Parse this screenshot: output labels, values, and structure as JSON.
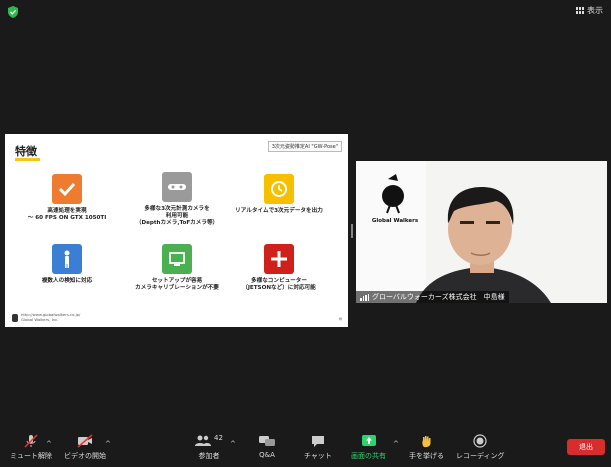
{
  "top": {
    "view_label": "表示"
  },
  "slide": {
    "title": "特徴",
    "tag": "3次元姿勢推定AI \"GW-Pose\"",
    "features": [
      {
        "line1": "高速処理を実現",
        "line2": "～ 60 FPS ON GTX 1050TI",
        "line3": "",
        "color": "#ee7c30",
        "icon": "check-icon"
      },
      {
        "line1": "多様な3次元計測カメラを",
        "line2": "利用可能",
        "line3": "（Depthカメラ,ToFカメラ等）",
        "color": "#9a9a9a",
        "icon": "camera-icon"
      },
      {
        "line1": "リアルタイムで3次元データを出力",
        "line2": "",
        "line3": "",
        "color": "#f6c000",
        "icon": "clock-icon"
      },
      {
        "line1": "複数人の検知に対応",
        "line2": "",
        "line3": "",
        "color": "#3b7fd4",
        "icon": "person-icon"
      },
      {
        "line1": "セットアップが容易",
        "line2": "カメラキャリブレーションが不要",
        "line3": "",
        "color": "#4caf50",
        "icon": "monitor-icon"
      },
      {
        "line1": "多様なコンピューター",
        "line2": "（JETSONなど）に対応可能",
        "line3": "",
        "color": "#d0201c",
        "icon": "plus-icon"
      }
    ],
    "footer_url": "http://www.globalwalkers.co.jp/",
    "footer_company": "Global Walkers, Inc."
  },
  "video": {
    "logo_text": "Global Walkers",
    "participant_name": "グローバルウォーカーズ株式会社　中島様"
  },
  "toolbar": {
    "mute": "ミュート解除",
    "video": "ビデオの開始",
    "participants": "参加者",
    "participants_count": "42",
    "qa": "Q&A",
    "chat": "チャット",
    "share": "画面の共有",
    "raise_hand": "手を挙げる",
    "record": "レコーディング",
    "leave": "退出"
  },
  "colors": {
    "share_green": "#2fd36e",
    "leave_red": "#d92c2c"
  }
}
